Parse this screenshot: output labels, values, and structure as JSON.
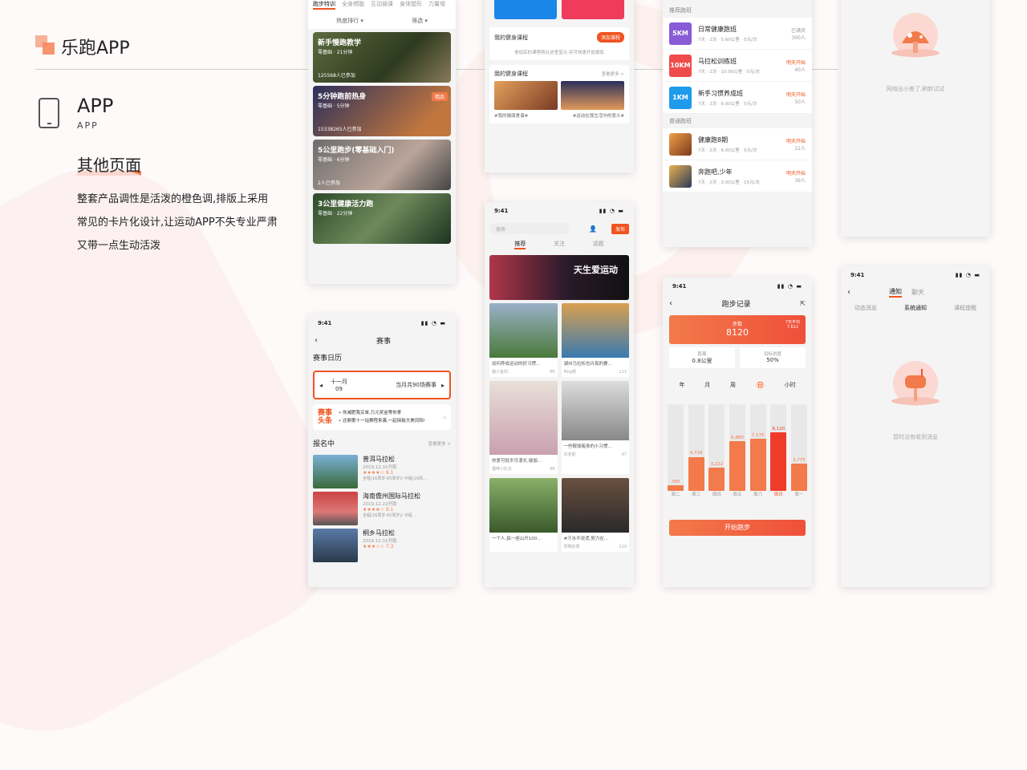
{
  "header": {
    "brand": "乐跑APP",
    "app_title": "APP",
    "app_sub": "APP",
    "section": "其他页面",
    "desc": "整套产品调性是活泼的橙色调,排版上采用常见的卡片化设计,让运动APP不失专业严肃又带一点生动活泼"
  },
  "courses": {
    "tabs": [
      "跑步特训",
      "全身燃脂",
      "互动操课",
      "身体塑形",
      "力量增"
    ],
    "sort": "热度排行 ▾",
    "filter": "筛选 ▾",
    "cards": [
      {
        "title": "新手慢跑教学",
        "sub": "零基础 · 21分钟",
        "count": "125568人已参加",
        "badge": ""
      },
      {
        "title": "5分钟跑前热身",
        "sub": "零基础 · 5分钟",
        "count": "15338265人已参加",
        "badge": "精品"
      },
      {
        "title": "5公里跑步(零基础入门)",
        "sub": "零基础 · 6分钟",
        "count": "2人已参加",
        "badge": ""
      },
      {
        "title": "3公里健康活力跑",
        "sub": "零基础 · 22分钟",
        "count": "",
        "badge": ""
      }
    ]
  },
  "fitness": {
    "title1": "我的健身课程",
    "btn": "添加课程",
    "hint": "参加后的课程将在这里显示,并可快速开始锻炼",
    "title2": "我的健身课程",
    "more": "查看更多 >",
    "tag1": "#我的健康食谱#",
    "tag2": "#运动在我生活中的意义#"
  },
  "plans": {
    "recommend": "推荐跑班",
    "normal": "普通跑班",
    "items": [
      {
        "badge": "5KM",
        "color": "#8a5bd6",
        "name": "日常健康跑班",
        "sub": "7天 · 2次 · 5.60公里 · 5元/次",
        "status": "已满员",
        "num": "300人",
        "hot": false
      },
      {
        "badge": "10KM",
        "color": "#ef4b4b",
        "name": "马拉松训练班",
        "sub": "7天 · 2次 · 10.00公里 · 5元/次",
        "status": "明天开始",
        "num": "40人",
        "hot": true
      },
      {
        "badge": "1KM",
        "color": "#1e9bea",
        "name": "新手习惯养成班",
        "sub": "7天 · 2次 · 6.00公里 · 5元/次",
        "status": "明天开始",
        "num": "50人",
        "hot": true
      }
    ],
    "normal_items": [
      {
        "name": "健康跑8期",
        "sub": "7天 · 2次 · 6.00公里 · 5元/次",
        "status": "明天开始",
        "num": "22人"
      },
      {
        "name": "奔跑吧,少年",
        "sub": "7天 · 2次 · 3.00公里 · 15元/次",
        "status": "明天开始",
        "num": "39人"
      }
    ]
  },
  "error": {
    "text": "网络出小差了,刷新试试"
  },
  "events": {
    "time": "9:41",
    "title": "赛事",
    "cal": "赛事日历",
    "month": "十一月",
    "day": "09",
    "count": "当月共90场赛事",
    "news_tag": "赛事头条",
    "news": [
      "• 你减肥我买单,万元奖金等你拿",
      "• 还剩第十一站赛程来袭,一起探秘大美凤阳!"
    ],
    "reg": "报名中",
    "more": "查看更多 >",
    "races": [
      {
        "name": "普洱马拉松",
        "date": "2019.12.31开跑",
        "score": "9.1",
        "info": "全程(16周岁-65周岁)/ 半程(16周..."
      },
      {
        "name": "海南儋州国际马拉松",
        "date": "2019.12.22开跑",
        "score": "9.1",
        "info": "全程(16周岁-65周岁)/ 半程 ..."
      },
      {
        "name": "桐乡马拉松",
        "date": "2019.12.01开跑",
        "score": "7.3",
        "info": ""
      }
    ]
  },
  "feed": {
    "time": "9:41",
    "search": "搜索",
    "post": "发布",
    "tabs": [
      "推荐",
      "关注",
      "话题"
    ],
    "banner": "天生爱运动",
    "items": [
      {
        "tx": "如何养成运动的好习惯...",
        "us": "鹿小鱼的..",
        "lk": "88"
      },
      {
        "tx": "湖州马拉松也许真的要...",
        "us": "Mog楼",
        "lk": "111"
      },
      {
        "tx": "热爱可抵岁月漫长,瑜伽...",
        "us": "猫咪小队长",
        "lk": "88"
      },
      {
        "tx": "一些鞍球瘦身的小习惯...",
        "us": "刘亚妮",
        "lk": "97"
      },
      {
        "tx": "一个人,搞一座山开100...",
        "us": "",
        "lk": ""
      },
      {
        "tx": "#汗水不说谎,努力在...",
        "us": "草莓的果",
        "lk": "219"
      }
    ]
  },
  "record": {
    "time": "9:41",
    "title": "跑步记录",
    "steps_label": "步数",
    "steps": "8120",
    "avg": "7天平均 7,612",
    "dist_label": "距离",
    "dist": "0.8公里",
    "goal_label": "目标进度",
    "goal": "50%",
    "periods": [
      "年",
      "月",
      "周",
      "日",
      "小时"
    ],
    "start": "开始跑步"
  },
  "chart_data": {
    "type": "bar",
    "categories": [
      "周二",
      "周三",
      "周四",
      "周五",
      "周六",
      "周日",
      "周一"
    ],
    "values": [
      760,
      4716,
      3222,
      6880,
      7175,
      8120,
      3775
    ],
    "ylim": [
      0,
      12000
    ],
    "highlight": "周日"
  },
  "messages": {
    "time": "9:41",
    "tabs": [
      "通知",
      "聊天"
    ],
    "sub": [
      "动态消息",
      "系统通知",
      "课程提醒"
    ],
    "empty": "暂时没有收到消息"
  }
}
